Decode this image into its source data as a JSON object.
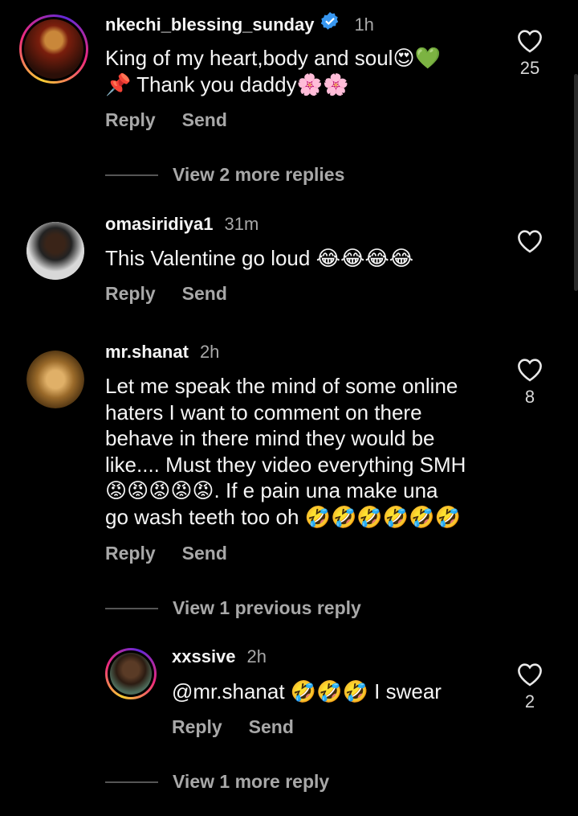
{
  "comments": [
    {
      "username": "nkechi_blessing_sunday",
      "time": "1h",
      "verified": true,
      "line1": "King of my heart,body and soul😍💚",
      "line2": "📌 Thank you daddy🌸🌸",
      "likes": "25",
      "reply": "Reply",
      "send": "Send",
      "view_more": "View 2 more replies"
    },
    {
      "username": "omasiridiya1",
      "time": "31m",
      "text": "This Valentine go loud 😂😂😂😂",
      "likes": "",
      "reply": "Reply",
      "send": "Send"
    },
    {
      "username": "mr.shanat",
      "time": "2h",
      "lines": [
        "Let me speak the mind of some online",
        "haters I want to comment on there",
        "behave in there mind they would be",
        "like.... Must they video everything SMH",
        "😡😡😡😡😡. If e pain una make una",
        "go wash teeth too oh 🤣🤣🤣🤣🤣🤣"
      ],
      "likes": "8",
      "reply": "Reply",
      "send": "Send",
      "view_previous": "View 1 previous reply"
    },
    {
      "username": "xxssive",
      "time": "2h",
      "text": "@mr.shanat 🤣🤣🤣 I swear",
      "likes": "2",
      "reply": "Reply",
      "send": "Send",
      "view_more": "View 1 more reply"
    }
  ],
  "colors": {
    "background": "#000000",
    "secondary_text": "#a8a8a8",
    "verified_blue": "#3897f0"
  },
  "icons": [
    "heart-icon",
    "verified-icon"
  ]
}
